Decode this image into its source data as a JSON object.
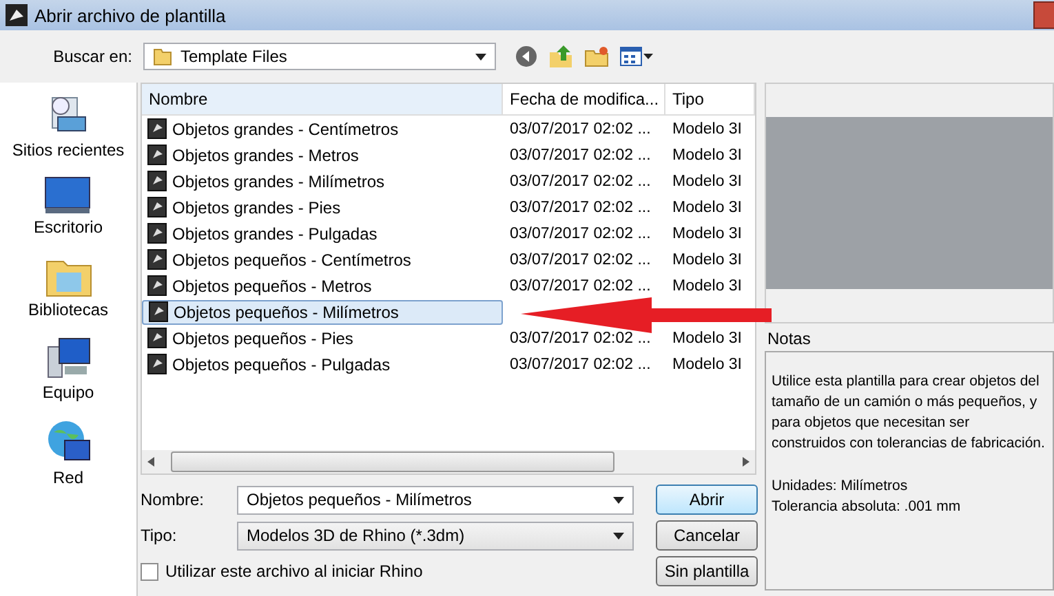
{
  "window": {
    "title": "Abrir archivo de plantilla"
  },
  "look_in": {
    "label": "Buscar en:",
    "value": "Template Files"
  },
  "sidebar": {
    "items": [
      {
        "label": "Sitios recientes",
        "kind": "recent"
      },
      {
        "label": "Escritorio",
        "kind": "desktop"
      },
      {
        "label": "Bibliotecas",
        "kind": "libraries"
      },
      {
        "label": "Equipo",
        "kind": "computer"
      },
      {
        "label": "Red",
        "kind": "network"
      }
    ]
  },
  "table": {
    "columns": [
      "Nombre",
      "Fecha de modifica...",
      "Tipo"
    ],
    "rows": [
      {
        "name": "Objetos grandes - Centímetros",
        "date": "03/07/2017 02:02 ...",
        "type": "Modelo 3I",
        "selected": false
      },
      {
        "name": "Objetos grandes - Metros",
        "date": "03/07/2017 02:02 ...",
        "type": "Modelo 3I",
        "selected": false
      },
      {
        "name": "Objetos grandes - Milímetros",
        "date": "03/07/2017 02:02 ...",
        "type": "Modelo 3I",
        "selected": false
      },
      {
        "name": "Objetos grandes - Pies",
        "date": "03/07/2017 02:02 ...",
        "type": "Modelo 3I",
        "selected": false
      },
      {
        "name": "Objetos grandes - Pulgadas",
        "date": "03/07/2017 02:02 ...",
        "type": "Modelo 3I",
        "selected": false
      },
      {
        "name": "Objetos pequeños - Centímetros",
        "date": "03/07/2017 02:02 ...",
        "type": "Modelo 3I",
        "selected": false
      },
      {
        "name": "Objetos pequeños - Metros",
        "date": "03/07/2017 02:02 ...",
        "type": "Modelo 3I",
        "selected": false
      },
      {
        "name": "Objetos pequeños - Milímetros",
        "selected": true
      },
      {
        "name": "Objetos pequeños - Pies",
        "date": "03/07/2017 02:02 ...",
        "type": "Modelo 3I",
        "selected": false
      },
      {
        "name": "Objetos pequeños - Pulgadas",
        "date": "03/07/2017 02:02 ...",
        "type": "Modelo 3I",
        "selected": false
      }
    ]
  },
  "form": {
    "name_label": "Nombre:",
    "name_value": "Objetos pequeños - Milímetros",
    "type_label": "Tipo:",
    "type_value": "Modelos 3D de Rhino (*.3dm)",
    "startup_checkbox": {
      "label": "Utilizar este archivo al iniciar Rhino",
      "checked": false
    }
  },
  "buttons": [
    "Abrir",
    "Cancelar",
    "Sin plantilla"
  ],
  "notes": {
    "label": "Notas",
    "text": "Utilice esta plantilla para crear objetos del tamaño de un camión o más pequeños, y para objetos que necesitan ser construidos con tolerancias de fabricación.",
    "units": "Unidades: Milímetros",
    "tolerance": "Tolerancia absoluta: .001 mm"
  }
}
